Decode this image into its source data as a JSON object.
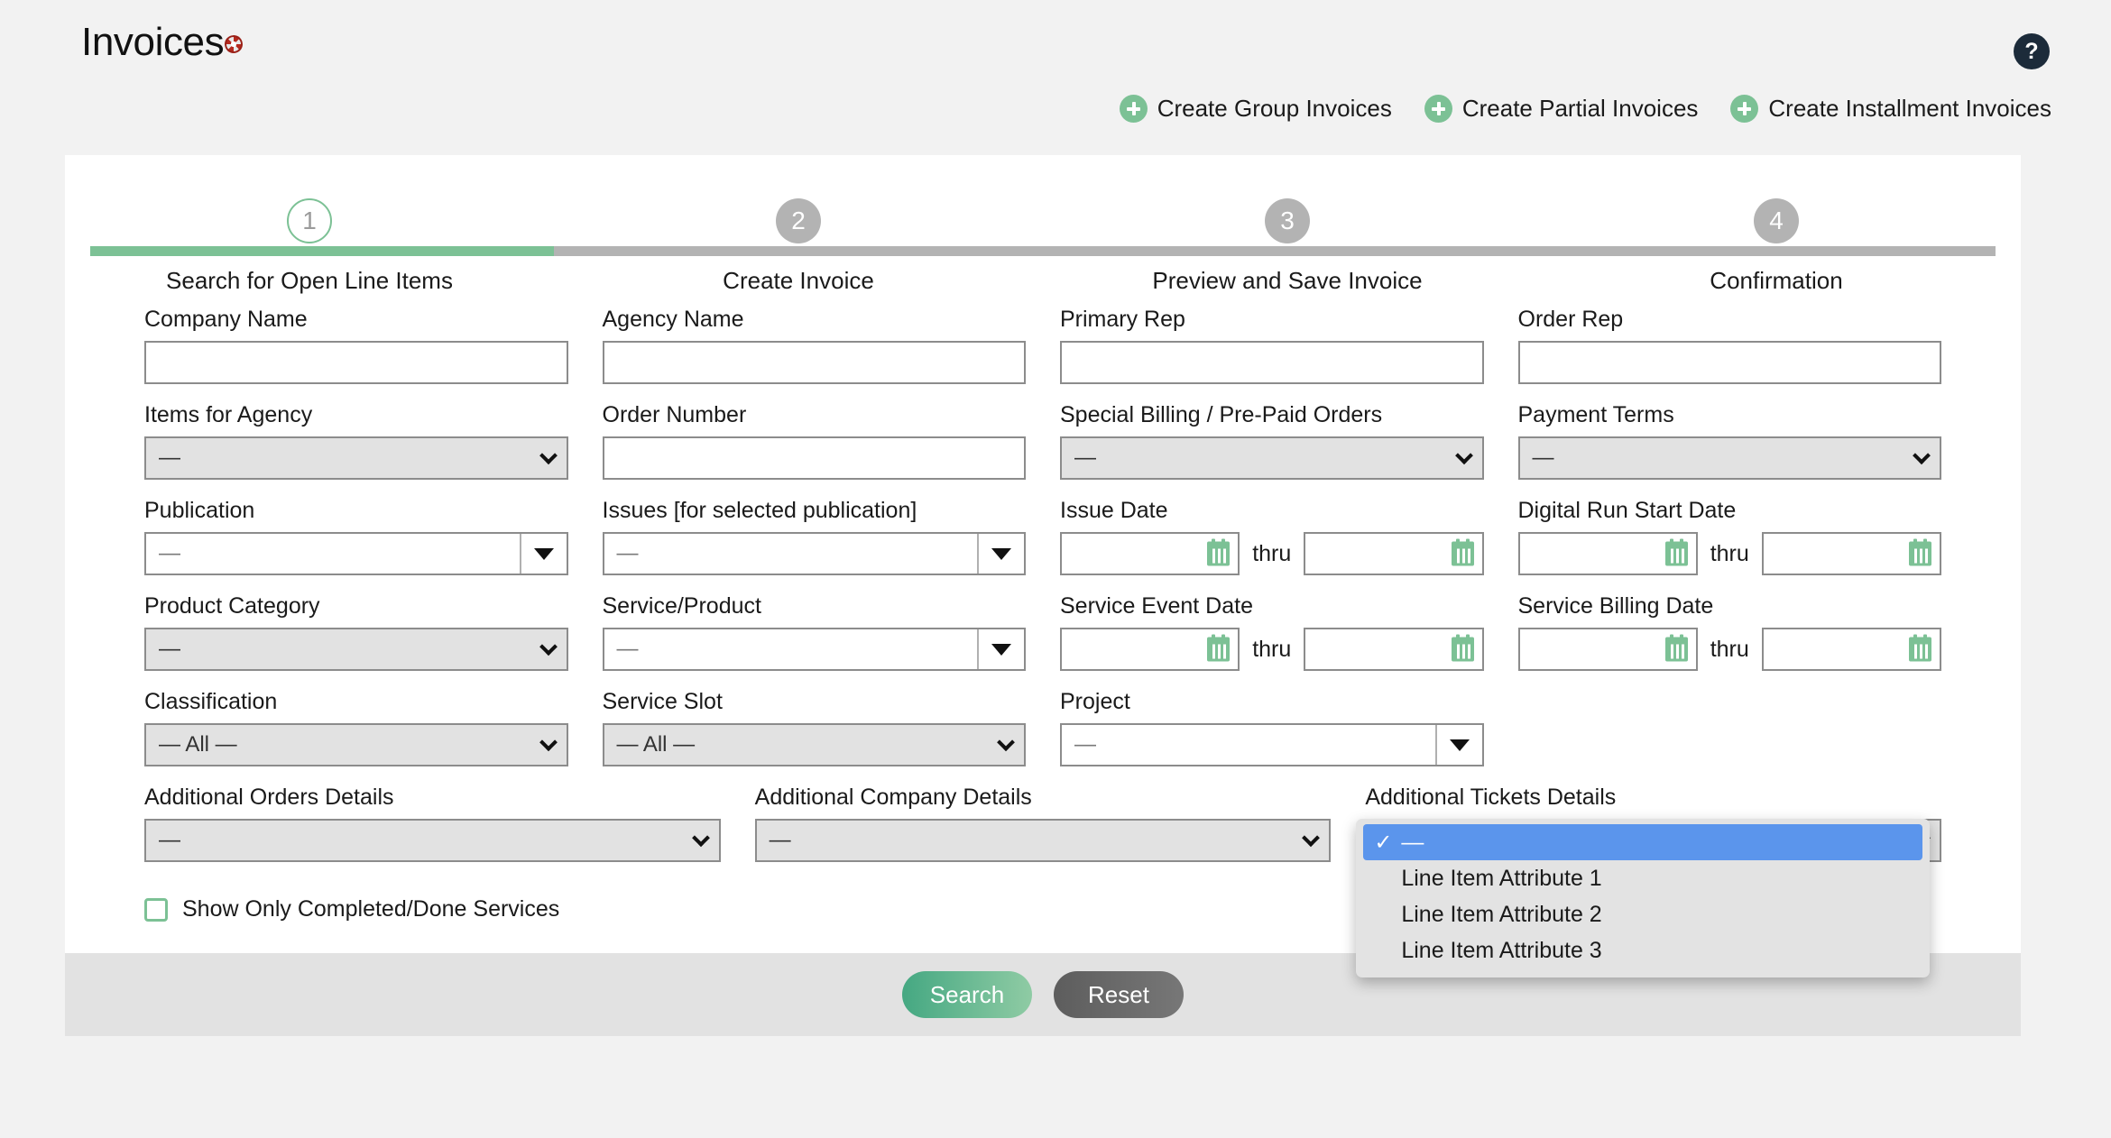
{
  "header": {
    "title": "Invoices",
    "title_icon": "lifesaver-icon",
    "help_icon": "?",
    "create_links": [
      {
        "label": "Create Group Invoices",
        "icon": "plus-circle-icon"
      },
      {
        "label": "Create Partial Invoices",
        "icon": "plus-circle-icon"
      },
      {
        "label": "Create Installment Invoices",
        "icon": "plus-circle-icon"
      }
    ]
  },
  "stepper": {
    "active_step": 1,
    "steps": [
      {
        "number": "1",
        "label": "Search for Open Line Items"
      },
      {
        "number": "2",
        "label": "Create Invoice"
      },
      {
        "number": "3",
        "label": "Preview and Save Invoice"
      },
      {
        "number": "4",
        "label": "Confirmation"
      }
    ]
  },
  "form": {
    "company_name": {
      "label": "Company Name",
      "value": "",
      "placeholder": ""
    },
    "agency_name": {
      "label": "Agency Name",
      "value": "",
      "placeholder": ""
    },
    "primary_rep": {
      "label": "Primary Rep",
      "value": "",
      "placeholder": ""
    },
    "order_rep": {
      "label": "Order Rep",
      "value": "",
      "placeholder": ""
    },
    "items_for_agency": {
      "label": "Items for Agency",
      "value": "—"
    },
    "order_number": {
      "label": "Order Number",
      "value": "",
      "placeholder": ""
    },
    "special_billing": {
      "label": "Special Billing / Pre-Paid Orders",
      "value": "—"
    },
    "payment_terms": {
      "label": "Payment Terms",
      "value": "—"
    },
    "publication": {
      "label": "Publication",
      "value": "—"
    },
    "issues": {
      "label": "Issues [for selected publication]",
      "value": "—"
    },
    "issue_date": {
      "label": "Issue Date",
      "from": "",
      "to": "",
      "separator": "thru"
    },
    "digital_run_start_date": {
      "label": "Digital Run Start Date",
      "from": "",
      "to": "",
      "separator": "thru"
    },
    "product_category": {
      "label": "Product Category",
      "value": "—"
    },
    "service_product": {
      "label": "Service/Product",
      "value": "—"
    },
    "service_event_date": {
      "label": "Service Event Date",
      "from": "",
      "to": "",
      "separator": "thru"
    },
    "service_billing_date": {
      "label": "Service Billing Date",
      "from": "",
      "to": "",
      "separator": "thru"
    },
    "classification": {
      "label": "Classification",
      "value": "— All —"
    },
    "service_slot": {
      "label": "Service Slot",
      "value": "— All —"
    },
    "project": {
      "label": "Project",
      "value": "—"
    },
    "additional_orders_details": {
      "label": "Additional Orders Details",
      "value": "—"
    },
    "additional_company_details": {
      "label": "Additional Company Details",
      "value": "—"
    },
    "additional_tickets_details": {
      "label": "Additional Tickets Details",
      "value": "—",
      "open": true,
      "selected_index": 0,
      "options": [
        "—",
        "Line Item Attribute 1",
        "Line Item Attribute 2",
        "Line Item Attribute 3"
      ]
    },
    "show_only_completed": {
      "label": "Show Only Completed/Done Services",
      "checked": false
    }
  },
  "footer": {
    "search_label": "Search",
    "reset_label": "Reset"
  },
  "colors": {
    "accent_green": "#7cc195",
    "page_bg": "#f2f2f2",
    "select_bg": "#e2e2e2",
    "dropdown_selected": "#5b95ec",
    "help_badge": "#1c2b3a"
  }
}
